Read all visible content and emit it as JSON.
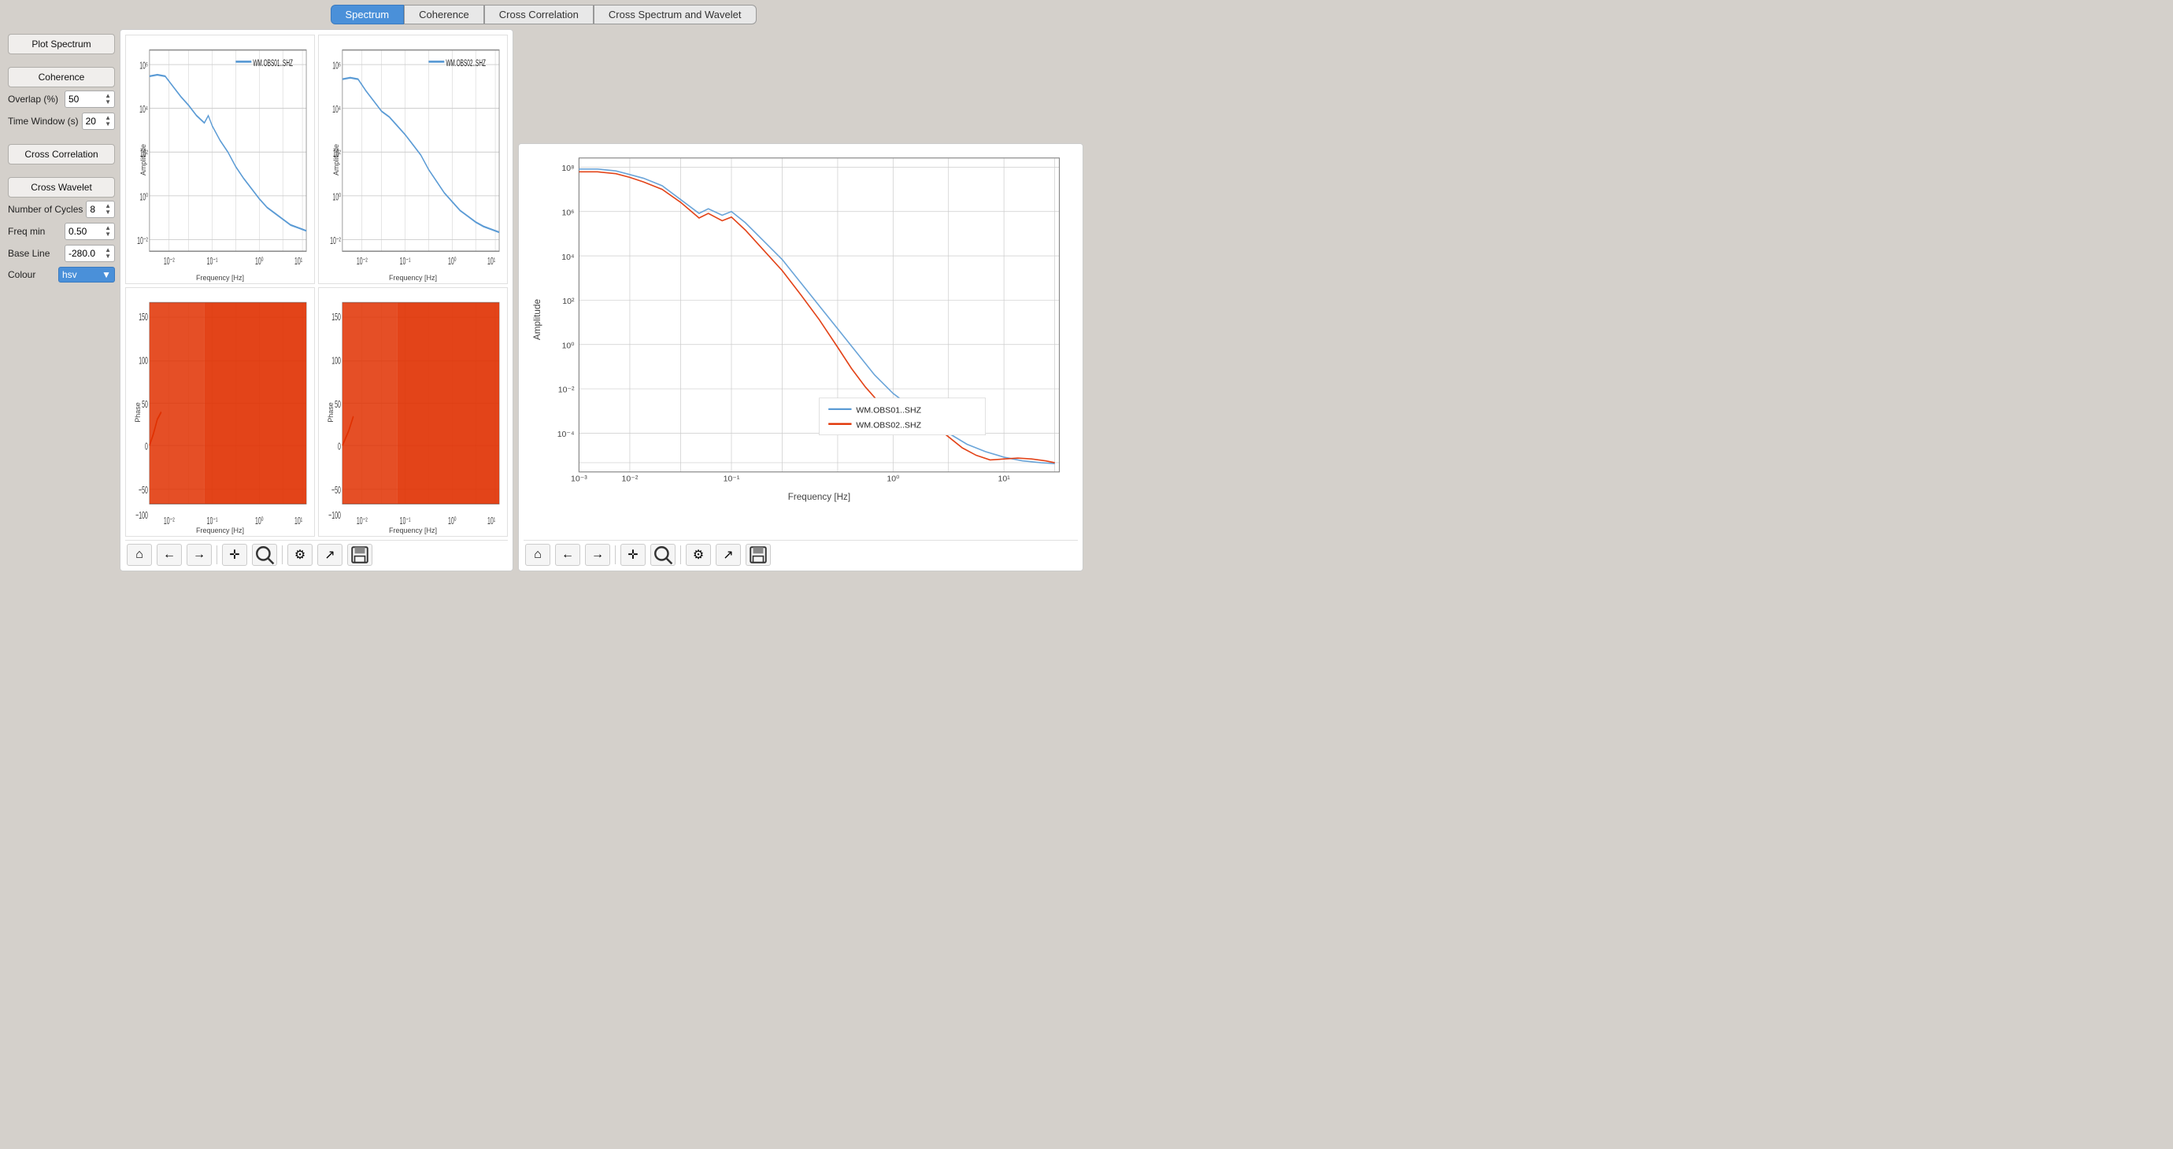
{
  "tabs": [
    {
      "label": "Spectrum",
      "active": true
    },
    {
      "label": "Coherence",
      "active": false
    },
    {
      "label": "Cross Correlation",
      "active": false
    },
    {
      "label": "Cross Spectrum and Wavelet",
      "active": false
    }
  ],
  "sidebar": {
    "plot_spectrum_label": "Plot Spectrum",
    "coherence_label": "Coherence",
    "cross_correlation_label": "Cross Correlation",
    "cross_wavelet_label": "Cross Wavelet",
    "fields": [
      {
        "label": "Overlap (%)",
        "value": "50"
      },
      {
        "label": "Time Window (s)",
        "value": "20"
      },
      {
        "label": "Number of Cycles",
        "value": "8"
      },
      {
        "label": "Freq min",
        "value": "0.50"
      },
      {
        "label": "Base Line",
        "value": "-280.0"
      }
    ],
    "colour_label": "Colour",
    "colour_value": "hsv"
  },
  "charts": {
    "top_left": {
      "title": "WM.OBS01..SHZ",
      "x_label": "Frequency [Hz]",
      "y_label": "Amplitude",
      "color": "#5b9bd5"
    },
    "top_right": {
      "title": "WM.OBS02..SHZ",
      "x_label": "Frequency [Hz]",
      "y_label": "Amplitude",
      "color": "#5b9bd5"
    },
    "bottom_left": {
      "x_label": "Frequency [Hz]",
      "y_label": "Phase",
      "color": "#e03000"
    },
    "bottom_right": {
      "x_label": "Frequency [Hz]",
      "y_label": "Phase",
      "color": "#e03000"
    }
  },
  "right_chart": {
    "x_label": "Frequency [Hz]",
    "y_label": "Amplitude",
    "legend": [
      {
        "label": "WM.OBS01..SHZ",
        "color": "#5b9bd5"
      },
      {
        "label": "WM.OBS02..SHZ",
        "color": "#e03000"
      }
    ]
  },
  "toolbar": {
    "home": "⌂",
    "back": "←",
    "forward": "→",
    "pan": "✛",
    "zoom": "🔍",
    "settings": "⚙",
    "trend": "↗",
    "save": "💾"
  }
}
